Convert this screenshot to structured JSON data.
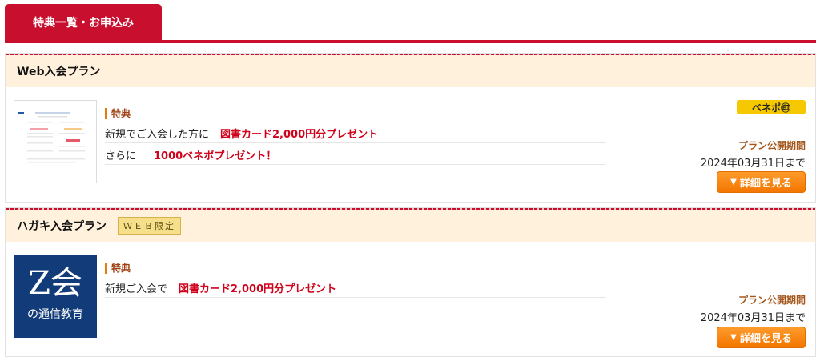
{
  "tab": {
    "label": "特典一覧・お申込み"
  },
  "plans": [
    {
      "title": "Web入会プラン",
      "badge": "",
      "benefit_label": "特典",
      "rows": [
        {
          "lead": "新規でご入会した方に",
          "highlight": "図書カード2,000円分プレゼント"
        },
        {
          "lead": "さらに",
          "highlight": "1000ベネポプレゼント！"
        }
      ],
      "points_logo": "ベネポ㊞",
      "period_label": "プラン公開期間",
      "period_date": "2024年03月31日まで",
      "detail_button": "詳細を見る"
    },
    {
      "title": "ハガキ入会プラン",
      "badge": "ＷＥＢ限定",
      "benefit_label": "特典",
      "rows": [
        {
          "lead": "新規ご入会で",
          "highlight": "図書カード2,000円分プレゼント"
        }
      ],
      "logo_big": "Z会",
      "logo_small": "の通信教育",
      "period_label": "プラン公開期間",
      "period_date": "2024年03月31日まで",
      "detail_button": "詳細を見る"
    }
  ],
  "colors": {
    "brand_red": "#c8102e",
    "header_bg": "#fff1dc",
    "button_orange": "#f47600",
    "highlight_red": "#d0021b"
  }
}
